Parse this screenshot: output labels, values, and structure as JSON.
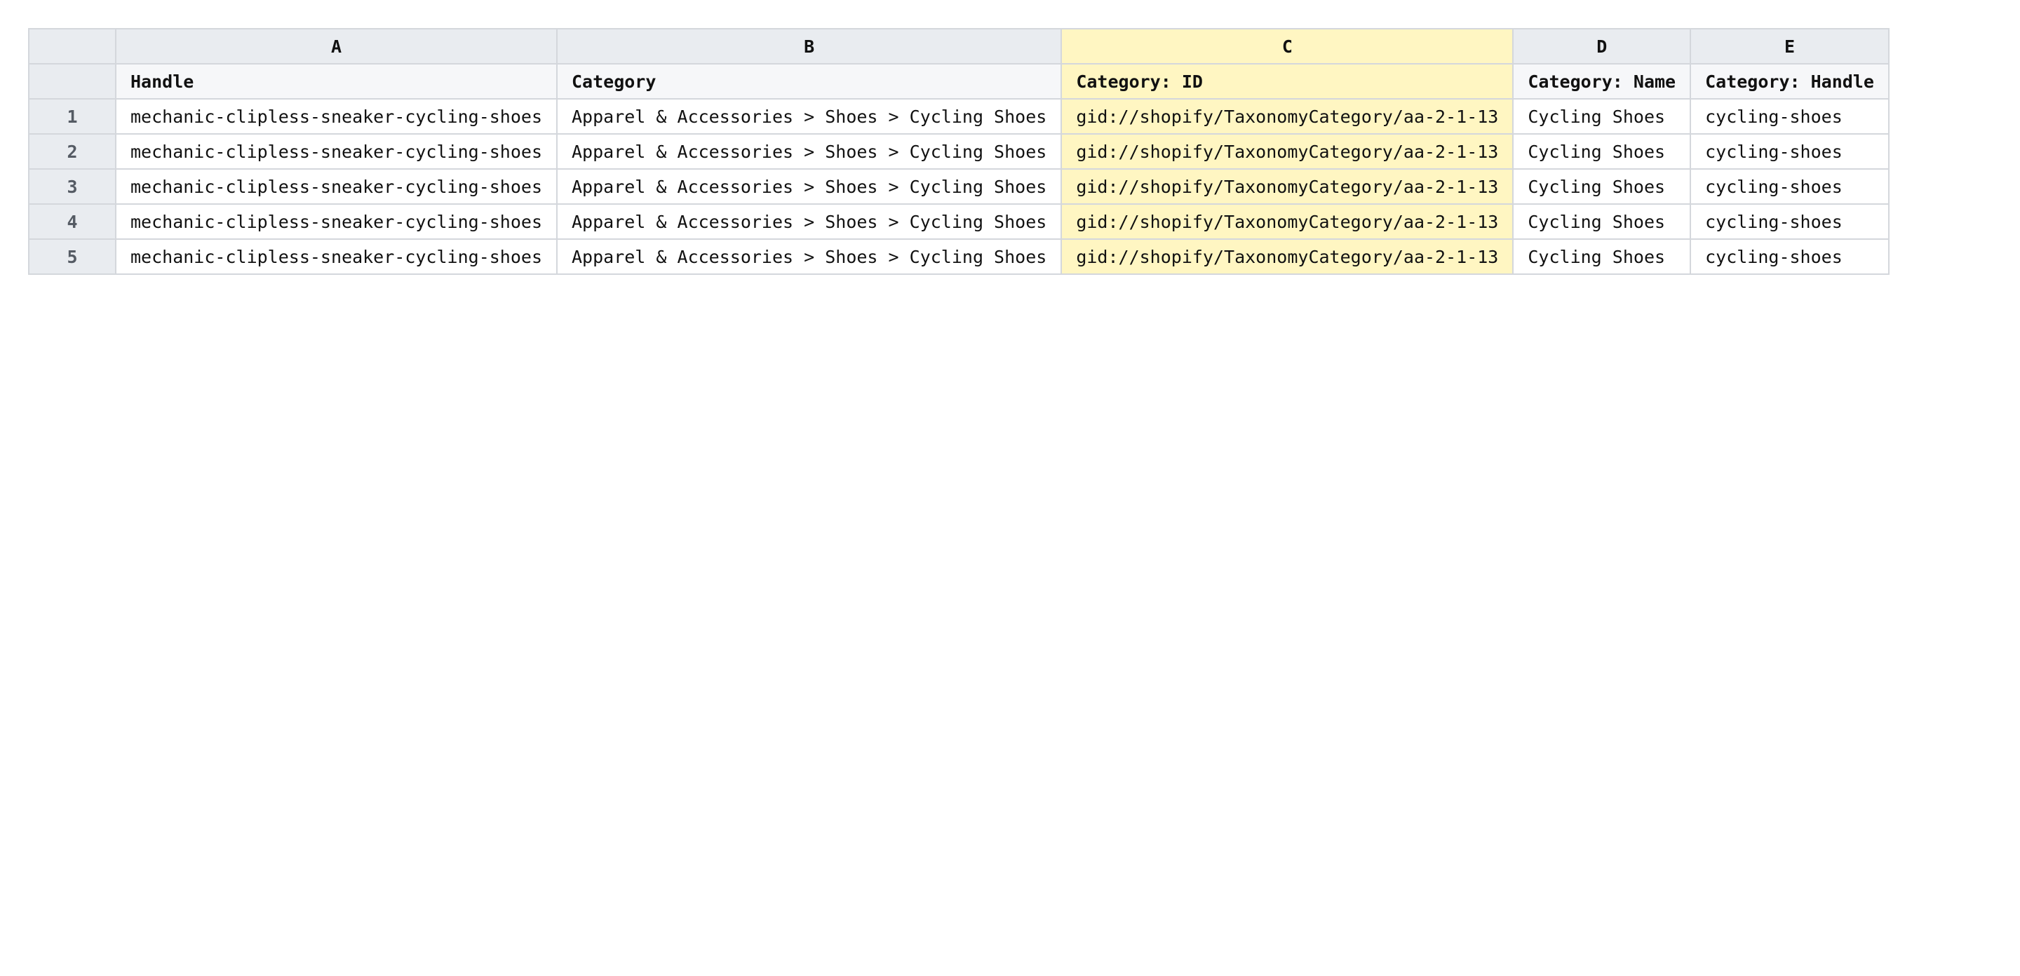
{
  "sheet": {
    "highlight_color": "#fff6c2",
    "columns": [
      "A",
      "B",
      "C",
      "D",
      "E"
    ],
    "headers": [
      "Handle",
      "Category",
      "Category: ID",
      "Category: Name",
      "Category: Handle"
    ],
    "rows": [
      {
        "index": "1",
        "cells": [
          "mechanic-clipless-sneaker-cycling-shoes",
          "Apparel & Accessories > Shoes > Cycling Shoes",
          "gid://shopify/TaxonomyCategory/aa-2-1-13",
          "Cycling Shoes",
          "cycling-shoes"
        ]
      },
      {
        "index": "2",
        "cells": [
          "mechanic-clipless-sneaker-cycling-shoes",
          "Apparel & Accessories > Shoes > Cycling Shoes",
          "gid://shopify/TaxonomyCategory/aa-2-1-13",
          "Cycling Shoes",
          "cycling-shoes"
        ]
      },
      {
        "index": "3",
        "cells": [
          "mechanic-clipless-sneaker-cycling-shoes",
          "Apparel & Accessories > Shoes > Cycling Shoes",
          "gid://shopify/TaxonomyCategory/aa-2-1-13",
          "Cycling Shoes",
          "cycling-shoes"
        ]
      },
      {
        "index": "4",
        "cells": [
          "mechanic-clipless-sneaker-cycling-shoes",
          "Apparel & Accessories > Shoes > Cycling Shoes",
          "gid://shopify/TaxonomyCategory/aa-2-1-13",
          "Cycling Shoes",
          "cycling-shoes"
        ]
      },
      {
        "index": "5",
        "cells": [
          "mechanic-clipless-sneaker-cycling-shoes",
          "Apparel & Accessories > Shoes > Cycling Shoes",
          "gid://shopify/TaxonomyCategory/aa-2-1-13",
          "Cycling Shoes",
          "cycling-shoes"
        ]
      }
    ]
  }
}
